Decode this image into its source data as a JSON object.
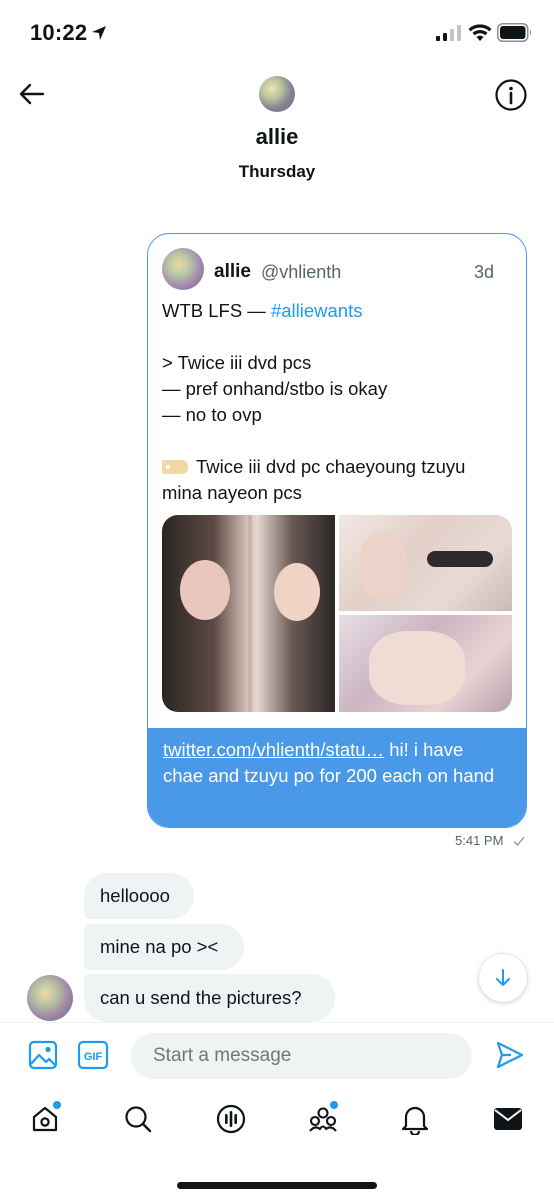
{
  "status_bar": {
    "time": "10:22"
  },
  "header": {
    "name": "allie",
    "day": "Thursday"
  },
  "tweet": {
    "author": "allie",
    "handle": "@vhlienth",
    "time": "3d",
    "lines": {
      "l1_prefix": "WTB LFS — ",
      "l1_hashtag": "#alliewants",
      "l2": "> Twice iii dvd pcs",
      "l3": "— pref onhand/stbo is okay",
      "l4": "— no to ovp",
      "l5": "Twice iii dvd pc chaeyoung tzuyu",
      "l6": "mina nayeon pcs"
    },
    "message_link": "twitter.com/vhlienth/statu…",
    "message_text": " hi! i have chae and tzuyu po for 200 each on hand",
    "sent_time": "5:41 PM"
  },
  "received_messages": [
    "helloooo",
    "mine na po ><",
    "can u send the pictures?"
  ],
  "composer": {
    "placeholder": "Start a message"
  },
  "icons": {
    "back": "back-arrow-icon",
    "info": "info-icon",
    "image": "image-icon",
    "gif": "gif-icon",
    "send": "send-icon",
    "tabs": [
      "home-icon",
      "search-icon",
      "spaces-icon",
      "communities-icon",
      "notifications-icon",
      "messages-icon"
    ]
  },
  "colors": {
    "accent": "#4a99e9",
    "link": "#1d9bf0",
    "bubble": "#eff3f4"
  }
}
